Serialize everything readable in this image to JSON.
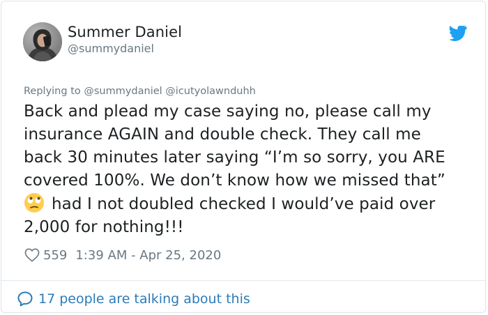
{
  "tweet": {
    "author": {
      "display_name": "Summer Daniel",
      "handle": "@summydaniel",
      "avatar": "profile-photo"
    },
    "brand_icon": "twitter-bird-icon",
    "brand_color": "#1da1f2",
    "replying_to": "Replying to @summydaniel @icutyolawnduhh",
    "text_lines": [
      "Back and plead my case saying no, please call my",
      "insurance AGAIN and double check. They call me",
      "back 30 minutes later saying “I’m so sorry, you ARE",
      "covered 100%. We don’t know how we missed that”",
      "had I not doubled checked I would’ve paid over",
      "2,000 for nothing!!!"
    ],
    "emoji": "face-with-rolling-eyes",
    "like_icon": "heart-icon",
    "likes": "559",
    "timestamp": "1:39 AM - Apr 25, 2020",
    "conversation_icon": "speech-bubble-icon",
    "talking_text": "17 people are talking about this",
    "link_color": "#2b7bb9"
  }
}
